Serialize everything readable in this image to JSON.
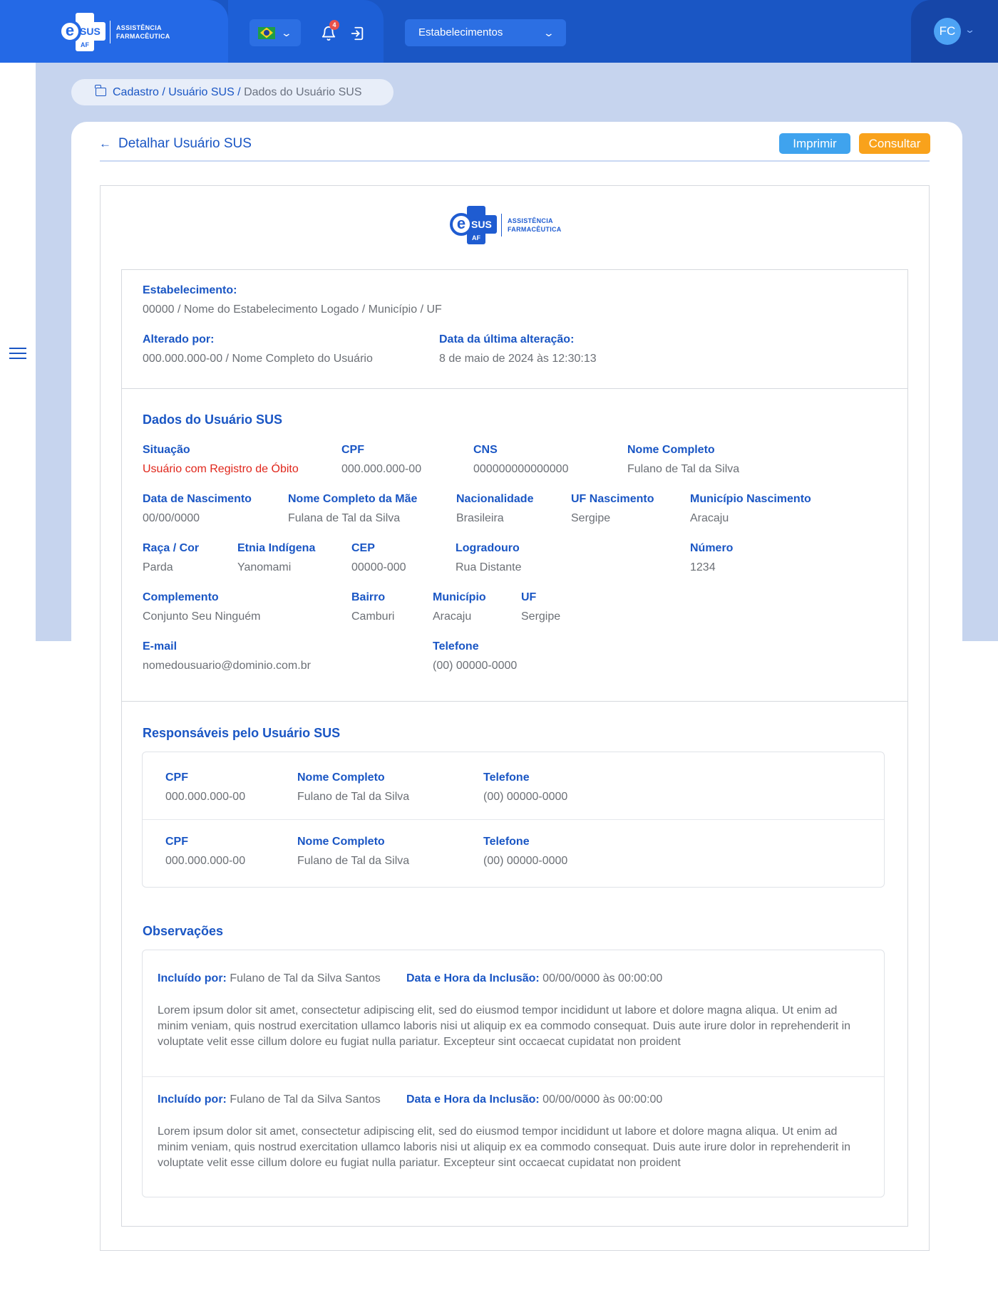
{
  "header": {
    "logo_line1": "ASSISTÊNCIA",
    "logo_line2": "FARMACÊUTICA",
    "logo_e": "e",
    "logo_sus": "SUS",
    "logo_af": "AF",
    "notification_count": "4",
    "establishment_select": "Estabelecimentos",
    "user_initials": "FC",
    "colors": {
      "primary": "#1a56c4",
      "accent_blue": "#3fa3ee",
      "accent_orange": "#f9a21b",
      "danger": "#e0261b"
    }
  },
  "breadcrumb": {
    "path": "Cadastro / Usuário SUS / ",
    "current": "Dados do Usuário SUS"
  },
  "page": {
    "title": "Detalhar Usuário SUS",
    "print_label": "Imprimir",
    "query_label": "Consultar"
  },
  "doc": {
    "estabelecimento_label": "Estabelecimento:",
    "estabelecimento_value": "00000 / Nome do Estabelecimento Logado / Município / UF",
    "alterado_label": "Alterado por:",
    "alterado_value": "000.000.000-00 / Nome Completo do Usuário",
    "data_alteracao_label": "Data da última alteração:",
    "data_alteracao_value": "8 de maio de 2024 às 12:30:13"
  },
  "dados": {
    "title": "Dados do Usuário SUS",
    "fields": [
      {
        "label": "Situação",
        "value": "Usuário com Registro de Óbito"
      },
      {
        "label": "CPF",
        "value": "000.000.000-00"
      },
      {
        "label": "CNS",
        "value": "000000000000000"
      },
      {
        "label": "Nome Completo",
        "value": "Fulano de Tal da Silva"
      },
      {
        "label": "Data de Nascimento",
        "value": "00/00/0000"
      },
      {
        "label": "Nome Completo da Mãe",
        "value": "Fulana de Tal da Silva"
      },
      {
        "label": "Nacionalidade",
        "value": "Brasileira"
      },
      {
        "label": "UF Nascimento",
        "value": "Sergipe"
      },
      {
        "label": "Município Nascimento",
        "value": "Aracaju"
      },
      {
        "label": "Raça / Cor",
        "value": "Parda"
      },
      {
        "label": "Etnia Indígena",
        "value": "Yanomami"
      },
      {
        "label": "CEP",
        "value": "00000-000"
      },
      {
        "label": "Logradouro",
        "value": "Rua Distante"
      },
      {
        "label": "Número",
        "value": "1234"
      },
      {
        "label": "Complemento",
        "value": "Conjunto Seu Ninguém"
      },
      {
        "label": "Bairro",
        "value": "Camburi"
      },
      {
        "label": "Município",
        "value": "Aracaju"
      },
      {
        "label": "UF",
        "value": "Sergipe"
      },
      {
        "label": "E-mail",
        "value": "nomedousuario@dominio.com.br"
      },
      {
        "label": "Telefone",
        "value": "(00) 00000-0000"
      }
    ]
  },
  "responsaveis": {
    "title": "Responsáveis pelo Usuário SUS",
    "cpf_label": "CPF",
    "nome_label": "Nome Completo",
    "telefone_label": "Telefone",
    "rows": [
      {
        "cpf": "000.000.000-00",
        "nome": "Fulano de Tal da Silva",
        "telefone": "(00) 00000-0000"
      },
      {
        "cpf": "000.000.000-00",
        "nome": "Fulano de Tal da Silva",
        "telefone": "(00) 00000-0000"
      }
    ]
  },
  "observacoes": {
    "title": "Observações",
    "incluido_label": "Incluído por:",
    "data_hora_label": "Data e Hora da Inclusão:",
    "items": [
      {
        "incluido_por": "Fulano de Tal da Silva Santos",
        "data_hora": "00/00/0000 às 00:00:00",
        "text": "Lorem ipsum dolor sit amet, consectetur adipiscing elit, sed do eiusmod tempor incididunt ut labore et dolore magna aliqua. Ut enim ad minim veniam, quis nostrud exercitation ullamco laboris nisi ut aliquip ex ea commodo consequat. Duis aute irure dolor in reprehenderit in voluptate velit esse cillum dolore eu fugiat nulla pariatur. Excepteur sint occaecat cupidatat non proident"
      },
      {
        "incluido_por": "Fulano de Tal da Silva Santos",
        "data_hora": "00/00/0000 às 00:00:00",
        "text": "Lorem ipsum dolor sit amet, consectetur adipiscing elit, sed do eiusmod tempor incididunt ut labore et dolore magna aliqua. Ut enim ad minim veniam, quis nostrud exercitation ullamco laboris nisi ut aliquip ex ea commodo consequat. Duis aute irure dolor in reprehenderit in voluptate velit esse cillum dolore eu fugiat nulla pariatur. Excepteur sint occaecat cupidatat non proident"
      }
    ]
  }
}
